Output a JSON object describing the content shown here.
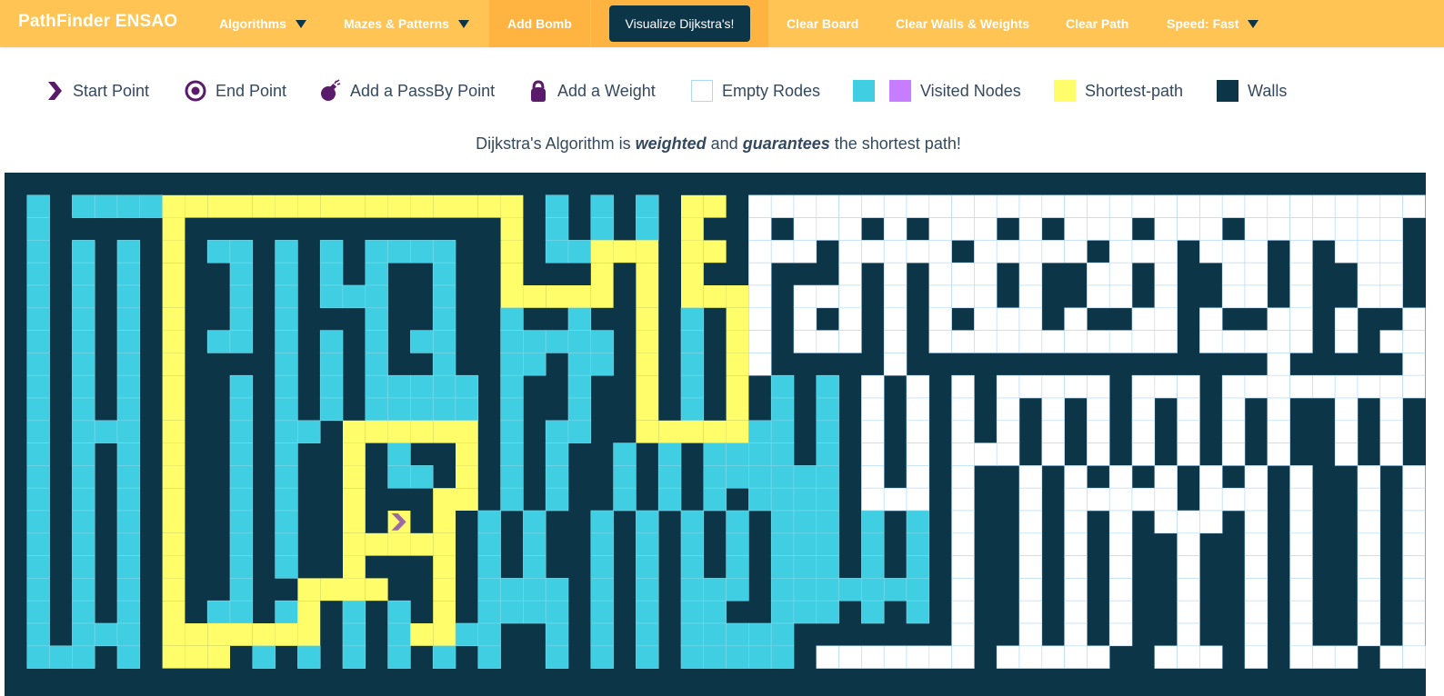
{
  "navbar": {
    "brand": "PathFinder ENSAO",
    "algorithms": "Algorithms",
    "mazes": "Mazes & Patterns",
    "add_bomb": "Add Bomb",
    "visualize": "Visualize Dijkstra's!",
    "clear_board": "Clear Board",
    "clear_walls": "Clear Walls & Weights",
    "clear_path": "Clear Path",
    "speed": "Speed: Fast"
  },
  "legend": {
    "start": "Start Point",
    "end": "End Point",
    "passby": "Add a PassBy Point",
    "weight": "Add a Weight",
    "empty": "Empty Rodes",
    "visited": "Visited Nodes",
    "shortest": "Shortest-path",
    "walls": "Walls"
  },
  "subtitle": {
    "prefix": "Dijkstra's Algorithm is ",
    "weighted": "weighted",
    "middle": " and ",
    "guarantees": "guarantees",
    "suffix": " the shortest path!"
  },
  "colors": {
    "navbar": "#ffc453",
    "wall": "#0c3547",
    "visited": "#40cee3",
    "visited_alt": "#c77dff",
    "path": "#fffe6a",
    "empty": "#ffffff",
    "cell_border": "#afd8f8",
    "start_icon": "#5b1b6b"
  },
  "grid": {
    "cols": 63,
    "rows": 23,
    "start": [
      17,
      15
    ],
    "cells": [
      "WWWWWWWWWWWWWWWWWWWWWWWWWWWWWWWWWWWWWWWWWWWWWWWWWWWWWWWWWWWWWWW",
      "WVWVVVVPPPPPPPPPPPPPPPPWVWVWVWPPWEEEEEEEEEEEEEEEEEEEEEEEEEEEEEEW",
      "WVWWWWWPWWWWWWWWWWWWWWPWVWVWVWPWWEWEEEWEWEEEWEWEEEWEEEWEEEEEEEW",
      "WVWVWVWPWVVWVWVWVVVVWWPWVVPPPWPPWEEEWEEEEEWEEEEEWEEEWEEEWEWEEEW",
      "WVWVWVWPWWVWVWVWVWWVWWPWWWPWPWPWWEWWWEWEWEEEWEWWEEWEWWEEWEWWEEW",
      "WVWVWVWPWWVWVWVVVWWVWWPPPPPWPWPPPEWEEEWEWEEEWEWWEEWEWWEEWEWWEEW",
      "WVWVWVWPWWVWVWWWVWWVWWVWWVWWPWVWPEWEWEWEWEWEEEWEWWEEWEWWEEWEWWEW",
      "WVWVWVWPWVVWVWVWVWVVWWVVVVVWPWVWPEWEEEWEWEEEEEEEEEEEWEEEEEWEWEEW",
      "WVWVWVWPWWWWVWVWVWWVWWVVWVVWPWVWPEWWWWWEWWWWWWWWWWWWWWWWEWWWWWEW",
      "WVWVWVWPWWVWVWVWVVVVVWVWWVWWPWVWPWVWVWEWEWEWEEEEEWEEEWEEEEEEEEEW",
      "WVWVWVWPWWVWVWVWVVVVVWVWWVWWPWVWPWVWVWEWEWEWEWEWEWEWEWEWEWWEWEWW",
      "WVWVVVWPWWVWVVWPPPPPPWVWVVWWPPPPPVVWVWEWEWEWEWEWEWEWEWEWEWWEWEWW",
      "WVWVWVWPWWVWVWWPWVWWPWVWVWWVWVWVVVVWVWEWEWEEEWEWEWEWEWEWEWWEWEWW",
      "WVWVWVWPWWVWVWWPWVVWPWVWVWWVWVWVVVVVVWEWEWEWWEWEWEWEWEWEWEWWEWEWW",
      "WVWVWVWPWWVWVWWPWWWPPWVWVWWVWVWVWVVVVWEEEWEWWEWEEEEEWEEEWEWWEWEWW",
      "WVWVWVWPWWVWVWWPWSWPWVWVWWVWVWVWVWVVVWVWVWEWWEWEWEWEEEWEWEWWEWEWW",
      "WVWVWVWPWWVWVWWPPPPPWVWVWWVWVWVWVWVVVWVWVWEWWEWEWEWWEWWEWEWWEWEWW",
      "WVWVWVWPWWVWVWWPWWWPWVWVWWVWVWVWVWVVVWVWVWEWWEWEWEWWEWWEWEWWEWEWW",
      "WVWVWVWPWWVWWPPPPWWPWVVVVWVWVWVVVWVVVVVVVWEWWEWEWEWWEWWEWEWWEWEWW",
      "WVWVWVWPWVVWVPWVWVWPWVVVVWVWVWVVWWVVVWVWVWEWWEWEWEWWEWWEWEWWEWEWW",
      "WVWVVVWPPPPPPPWVWVPPVVWWVWVWVWVVVVVWWWWWWWEWWEWEWEWWEWWEWEWWEWEWW",
      "WVVVWVWPPPWVWVWVWVWVWVWWVWVWVWVVVVVWEEEEEEEWEEEEEWWEEEWEWEEEWEEEW",
      "WWWWWWWWWWWWWWWWWWWWWWWWWWWWWWWWWWWWWWWWWWWWWWWWWWWWWWWWWWWWWWW"
    ]
  }
}
